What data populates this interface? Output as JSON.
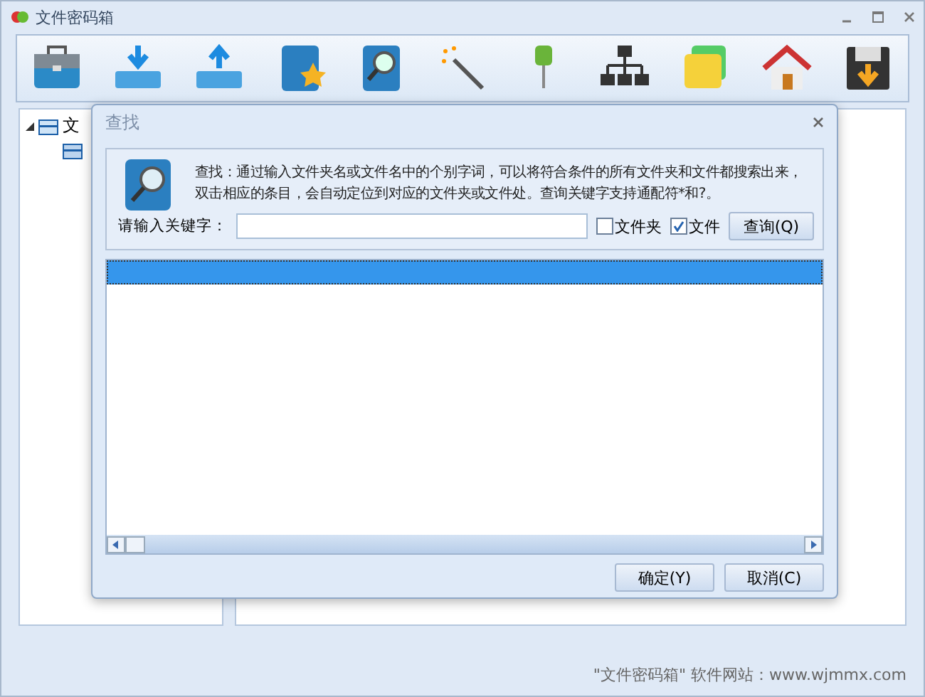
{
  "window": {
    "title": "文件密码箱"
  },
  "tree": {
    "items": [
      {
        "label": "文",
        "expanded": true,
        "children": [
          {
            "kind": "folder"
          }
        ]
      }
    ]
  },
  "dialog": {
    "title": "查找",
    "description": "查找：通过输入文件夹名或文件名中的个别字词，可以将符合条件的所有文件夹和文件都搜索出来，双击相应的条目，会自动定位到对应的文件夹或文件处。查询关键字支持通配符*和?。",
    "keyword_label": "请输入关键字：",
    "options": [
      {
        "label": "文件夹",
        "checked": false
      },
      {
        "label": "文件",
        "checked": true
      }
    ],
    "search_button": "查询(Q)",
    "results": [
      {
        "selected": true
      }
    ],
    "buttons": [
      "确定(Y)",
      "取消(C)"
    ]
  },
  "status_bar": {
    "text": "\"文件密码箱\"  软件网站：www.wjmmx.com"
  }
}
